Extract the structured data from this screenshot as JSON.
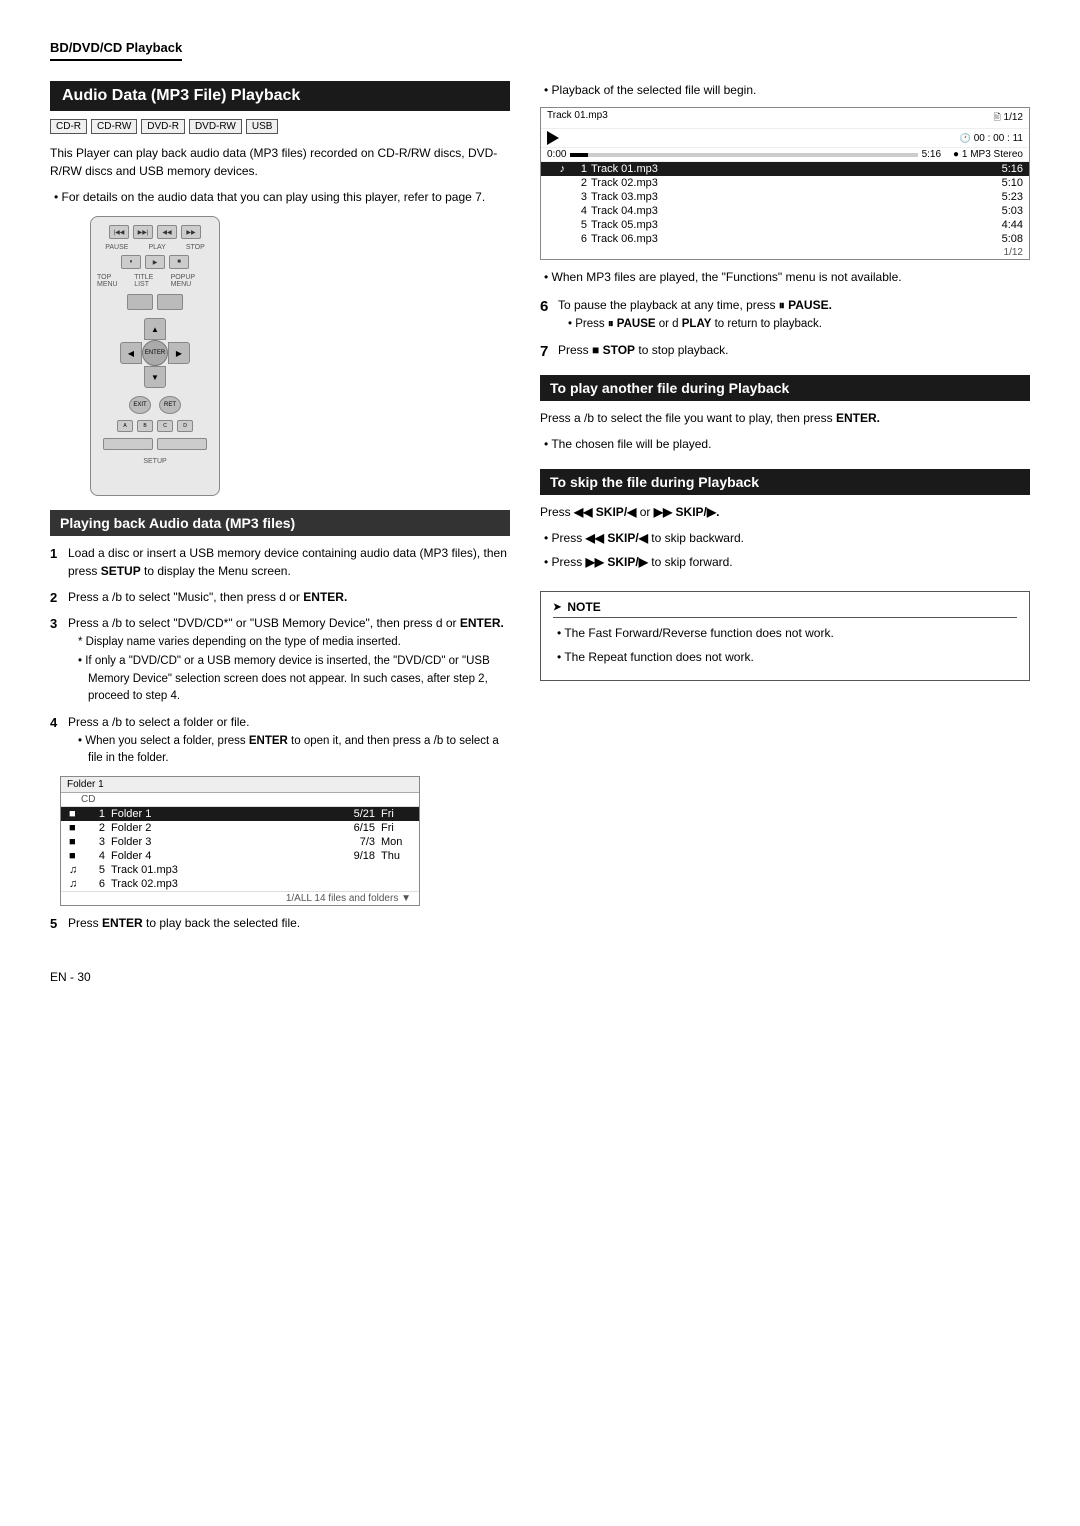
{
  "header": {
    "section": "BD/DVD/CD Playback"
  },
  "left": {
    "title": "Audio Data (MP3 File) Playback",
    "badges": [
      "CD-R",
      "CD-RW",
      "DVD-R",
      "DVD-RW",
      "USB"
    ],
    "intro": "This Player can play back audio data (MP3 files) recorded on CD-R/RW discs, DVD-R/RW discs and USB memory devices.",
    "intro_bullet": "For details on the audio data that you can play using this player, refer to page 7.",
    "sub_section": "Playing back Audio data (MP3 files)",
    "steps": [
      {
        "num": "1",
        "text": "Load a disc or insert a USB memory device containing audio data (MP3 files), then press SETUP to display the Menu screen."
      },
      {
        "num": "2",
        "text": "Press a /b  to select \"Music\", then press d  or ENTER."
      },
      {
        "num": "3",
        "text": "Press a /b  to select \"DVD/CD*\" or \"USB Memory Device\", then press d  or ENTER.",
        "subs": [
          "* Display name varies depending on the type of media inserted.",
          "• If only a \"DVD/CD\" or a USB memory device is inserted, the \"DVD/CD\" or \"USB Memory Device\" selection screen does not appear. In such cases, after step 2, proceed to step 4."
        ]
      },
      {
        "num": "4",
        "text": "Press a /b  to select a folder or file.",
        "subs": [
          "• When you select a folder, press ENTER to open it, and then press a /b  to select a file in the folder."
        ]
      }
    ],
    "folder_screen": {
      "header": "Folder 1",
      "subheader": "CD",
      "rows": [
        {
          "icon": "■",
          "num": "1",
          "name": "Folder 1",
          "size": "5/21",
          "day": "Fri",
          "selected": true
        },
        {
          "icon": "■",
          "num": "2",
          "name": "Folder 2",
          "size": "6/15",
          "day": "Fri",
          "selected": false
        },
        {
          "icon": "■",
          "num": "3",
          "name": "Folder 3",
          "size": "7/3",
          "day": "Mon",
          "selected": false
        },
        {
          "icon": "■",
          "num": "4",
          "name": "Folder 4",
          "size": "9/18",
          "day": "Thu",
          "selected": false
        },
        {
          "icon": "♫",
          "num": "5",
          "name": "Track 01.mp3",
          "size": "",
          "day": "",
          "selected": false
        },
        {
          "icon": "♫",
          "num": "6",
          "name": "Track 02.mp3",
          "size": "",
          "day": "",
          "selected": false
        }
      ],
      "footer": "1/ALL  14 files and folders ▼"
    },
    "step5": "Press ENTER to play back the selected file."
  },
  "right": {
    "bullet_top": "Playback of the selected file will begin.",
    "playback_screen": {
      "track_name": "Track 01.mp3",
      "track_counter": "1/12",
      "time_elapsed": "0:00",
      "time_total": "5:16",
      "time_hms": "00 : 00 : 11",
      "format": "1  MP3 Stereo",
      "tracks": [
        {
          "arrow": "♪",
          "num": "1",
          "name": "Track 01.mp3",
          "time": "5:16",
          "selected": true
        },
        {
          "arrow": "",
          "num": "2",
          "name": "Track 02.mp3",
          "time": "5:10",
          "selected": false
        },
        {
          "arrow": "",
          "num": "3",
          "name": "Track 03.mp3",
          "time": "5:23",
          "selected": false
        },
        {
          "arrow": "",
          "num": "4",
          "name": "Track 04.mp3",
          "time": "5:03",
          "selected": false
        },
        {
          "arrow": "",
          "num": "5",
          "name": "Track 05.mp3",
          "time": "4:44",
          "selected": false
        },
        {
          "arrow": "",
          "num": "6",
          "name": "Track 06.mp3",
          "time": "5:08",
          "selected": false
        }
      ],
      "footer": "1/12"
    },
    "bullet_mp3": "When MP3 files are played, the \"Functions\" menu is not available.",
    "step6_num": "6",
    "step6_text": "To pause the playback at any time, press",
    "step6_bold": "PAUSE.",
    "step6_sub": "Press  PAUSE or d  PLAY to return to playback.",
    "step7_num": "7",
    "step7_text": "Press",
    "step7_bold": "STOP",
    "step7_rest": "to stop playback.",
    "section2": "To play another file during Playback",
    "section2_body": "Press a /b  to select the file you want to play, then press ENTER.",
    "section2_bullet": "The chosen file will be played.",
    "section3": "To skip the file during Playback",
    "section3_body": "Press",
    "section3_skip": "◀◀  SKIP/◀ or  ▶▶  SKIP/▶.",
    "section3_b1": "Press  ◀◀  SKIP/◀ to skip backward.",
    "section3_b2": "Press  ▶▶  SKIP/▶ to skip forward.",
    "note": {
      "title": "NOTE",
      "bullets": [
        "The Fast Forward/Reverse function does not work.",
        "The Repeat function does not work."
      ]
    }
  },
  "footer": {
    "page": "EN -  30"
  }
}
